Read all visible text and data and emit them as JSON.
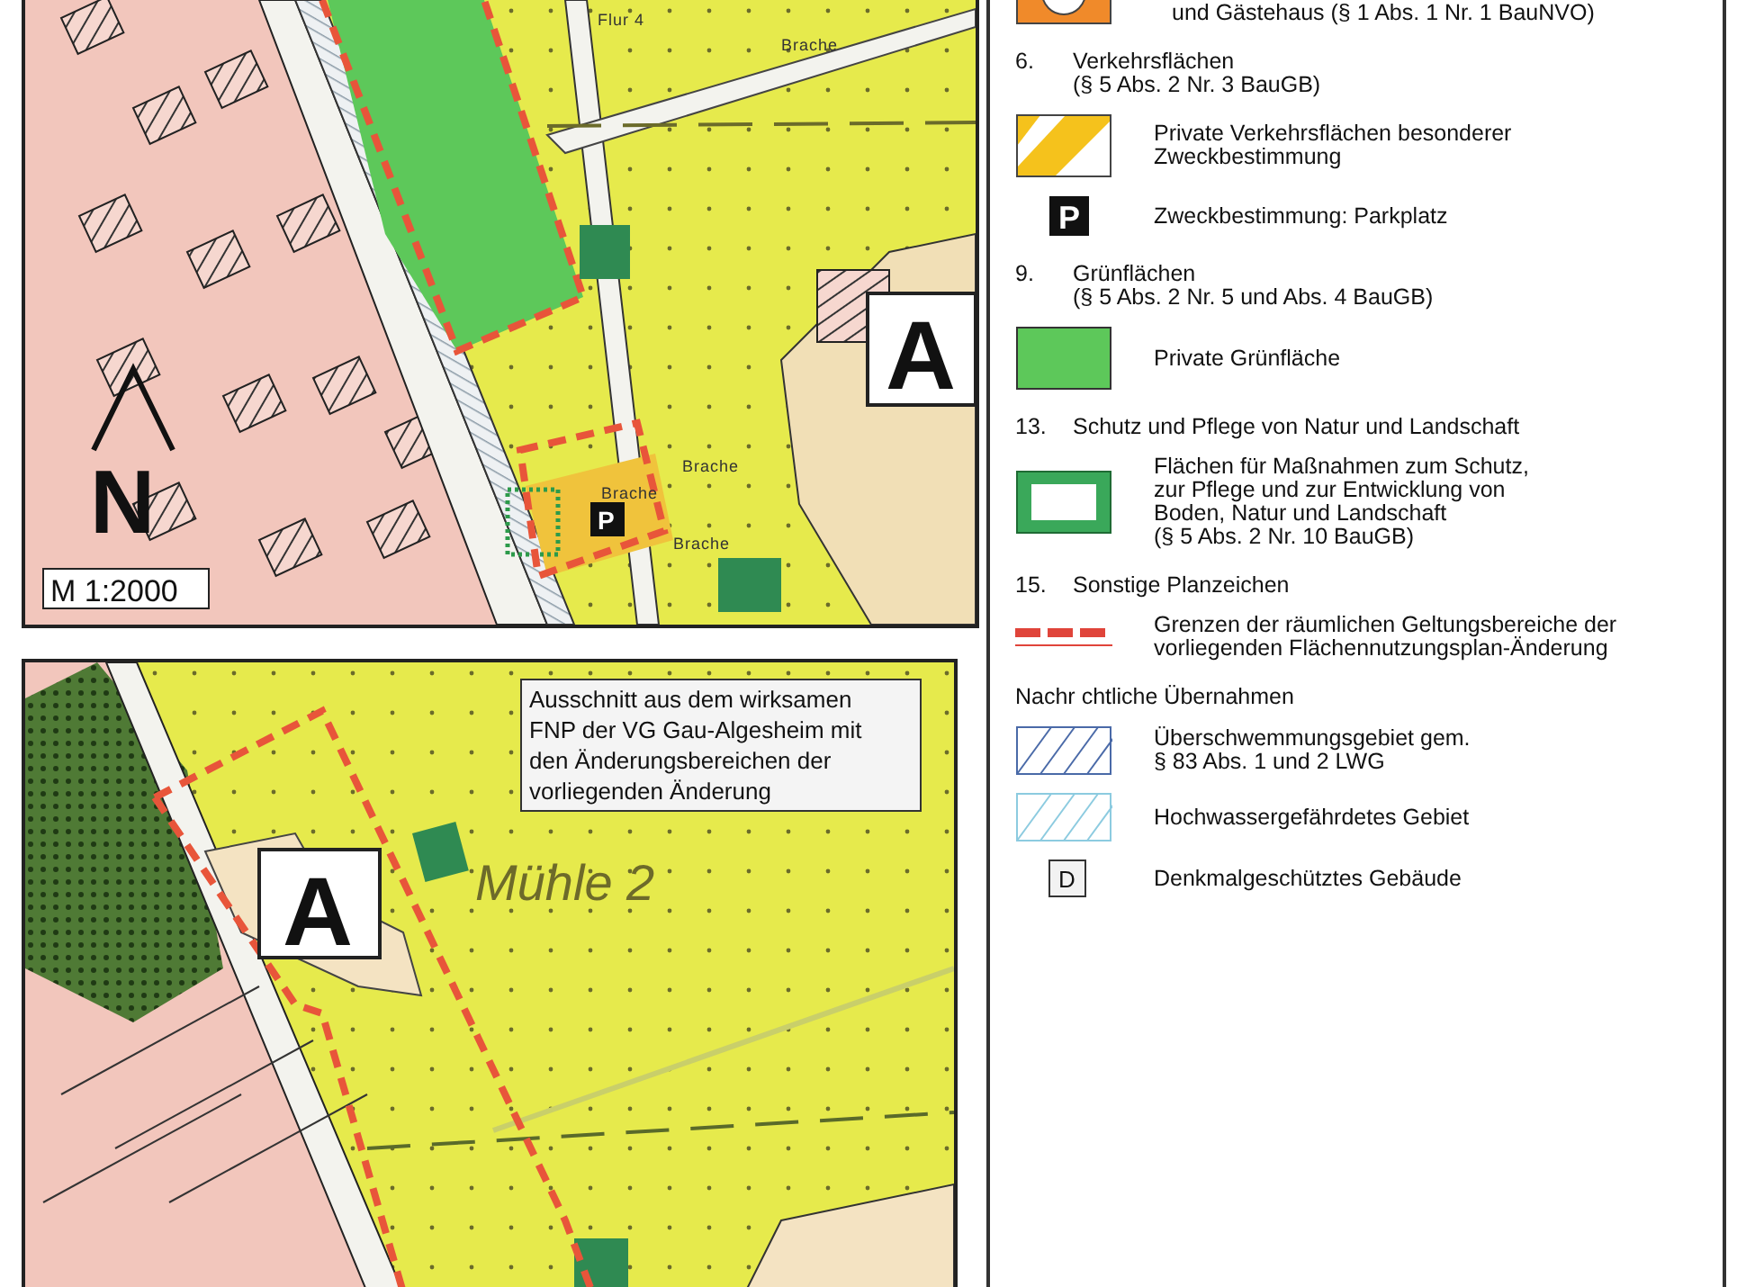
{
  "top_map": {
    "labels": [
      "Flur 4",
      "Brache",
      "Brache",
      "Brache",
      "Brache"
    ],
    "north_label": "N",
    "scale": "M 1:2000",
    "monument": "A",
    "parking": "P"
  },
  "bottom_map": {
    "callout": "Ausschnitt aus dem wirksamen\nFNP der VG Gau-Algesheim mit\nden Änderungsbereichen der\nvorliegenden Änderung",
    "place": "Mühle 2",
    "monument": "A"
  },
  "legend": {
    "sections": [
      {
        "items": [
          {
            "kind": "orange-symbol",
            "text": "und Gästehaus (§ 1 Abs. 1 Nr. 1 BauNVO)"
          }
        ]
      },
      {
        "number": "6.",
        "title": "Verkehrsflächen",
        "citation": "(§ 5 Abs. 2 Nr. 3 BauGB)",
        "items": [
          {
            "kind": "hatch-yellow",
            "text": "Private Verkehrsflächen besonderer\nZweckbestimmung"
          },
          {
            "kind": "parking",
            "symbol": "P",
            "text": "Zweckbestimmung: Parkplatz"
          }
        ]
      },
      {
        "number": "9.",
        "title": "Grünflächen",
        "citation": "(§ 5 Abs. 2 Nr. 5 und Abs. 4 BauGB)",
        "items": [
          {
            "kind": "green",
            "text": "Private Grünfläche"
          }
        ]
      },
      {
        "number": "13.",
        "title": "Schutz und Pflege von Natur und Landschaft",
        "items": [
          {
            "kind": "green-frame",
            "text": "Flächen für Maßnahmen zum Schutz,\nzur Pflege und zur Entwicklung von\nBoden, Natur und Landschaft\n(§ 5 Abs. 2 Nr. 10 BauGB)"
          }
        ]
      },
      {
        "number": "15.",
        "title": "Sonstige Planzeichen",
        "items": [
          {
            "kind": "red-dash",
            "text": "Grenzen der räumlichen Geltungsbereiche der\nvorliegenden Flächennutzungsplan-Änderung"
          }
        ]
      },
      {
        "title": "Nachr chtliche Übernahmen",
        "items": [
          {
            "kind": "blue-hatch",
            "text": "Überschwemmungsgebiet gem.\n§ 83 Abs. 1 und 2 LWG"
          },
          {
            "kind": "lightblue-hatch",
            "text": "Hochwassergefährdetes Gebiet"
          },
          {
            "kind": "monument",
            "symbol": "D",
            "text": "Denkmalgeschütztes Gebäude"
          }
        ]
      }
    ]
  }
}
